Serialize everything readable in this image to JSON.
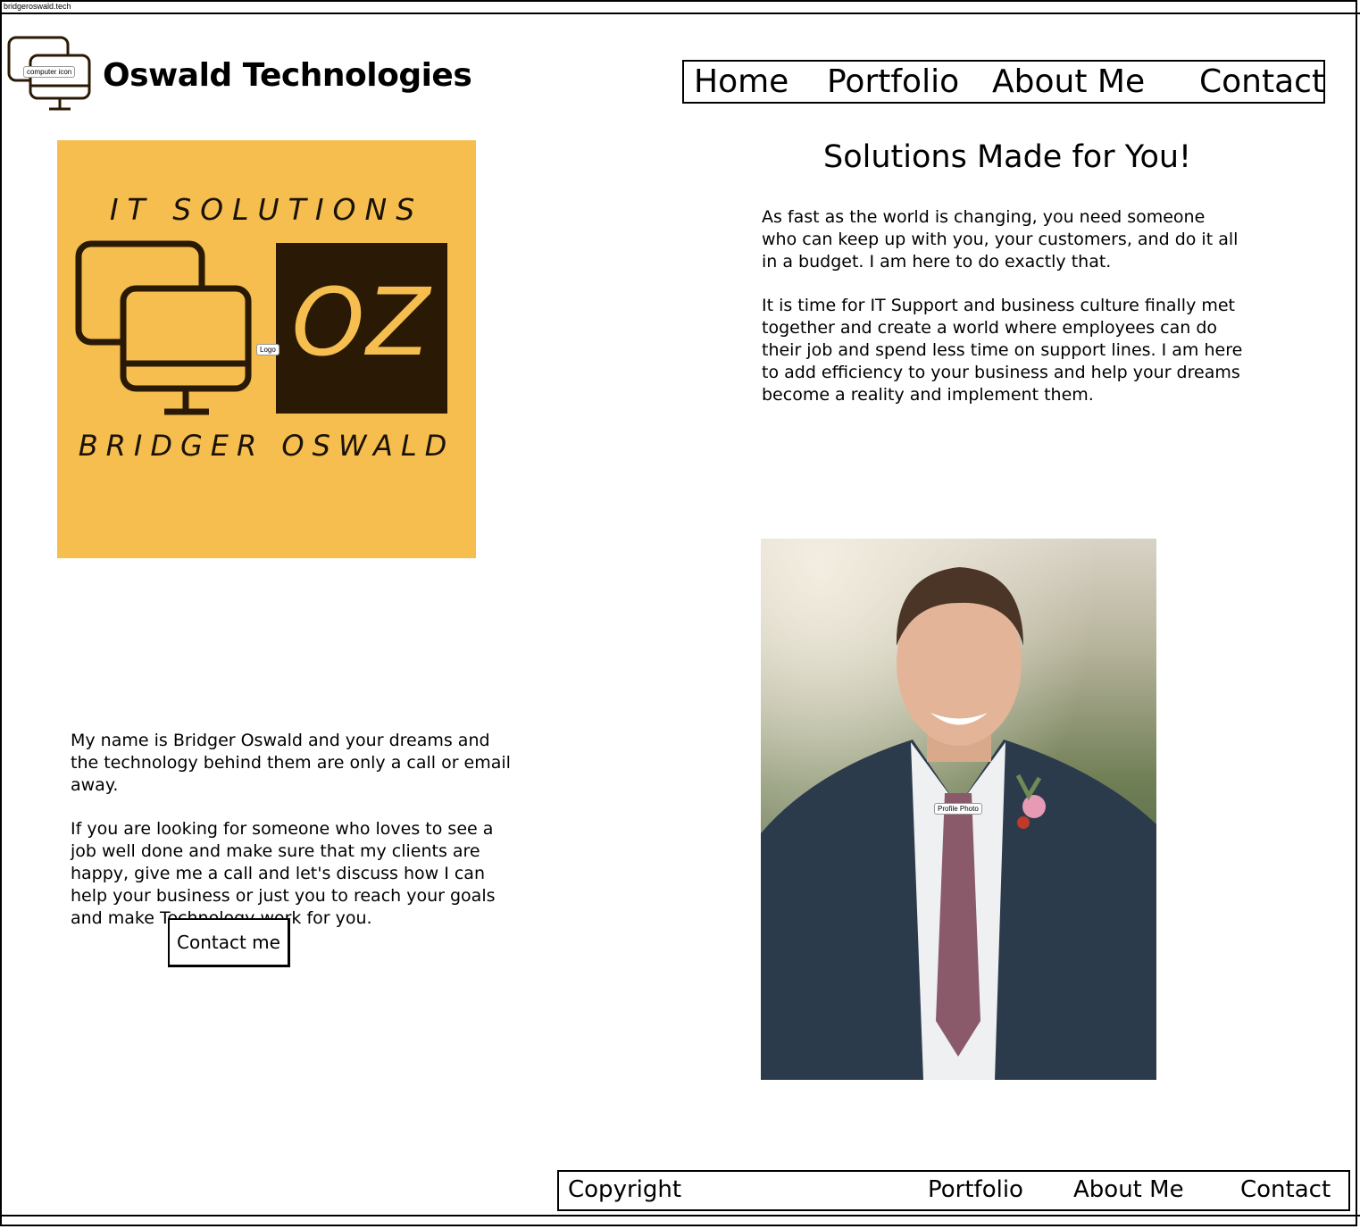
{
  "browser": {
    "url": "bridgeroswald.tech"
  },
  "header": {
    "brand_icon_annotation": "computer icon",
    "brand_title": "Oswald Technologies",
    "nav": [
      "Home",
      "Portfolio",
      "About Me",
      "Contact"
    ]
  },
  "logo": {
    "annotation": "Logo",
    "top_text": "IT SOLUTIONS",
    "monogram": "OZ",
    "bottom_text": "BRIDGER OSWALD",
    "colors": {
      "background": "#F5BE4F",
      "dark": "#2A1A05"
    }
  },
  "hero": {
    "title": "Solutions Made for You!",
    "paragraphs": [
      "As fast as the world is changing, you need someone who can keep up with you, your customers, and do it all in a budget. I am here to do exactly that.",
      "It is time for IT Support and business culture finally met together and create a world where employees can do their job and spend less time on support lines. I am here to add efficiency to your business and help your dreams become a reality and implement them."
    ]
  },
  "bio": {
    "paragraphs": [
      "My name is Bridger Oswald and your dreams and the technology behind them are only a call or email away.",
      "If you are looking for someone who loves to see a job well done and make sure that my clients are happy, give me a call and let's discuss how I can help your business or just you to reach your goals and make Technology work for you."
    ],
    "button_label": "Contact me"
  },
  "profile_photo": {
    "annotation": "Profile Photo"
  },
  "footer": {
    "copyright": "Copyright",
    "links": [
      "Portfolio",
      "About Me",
      "Contact"
    ]
  }
}
